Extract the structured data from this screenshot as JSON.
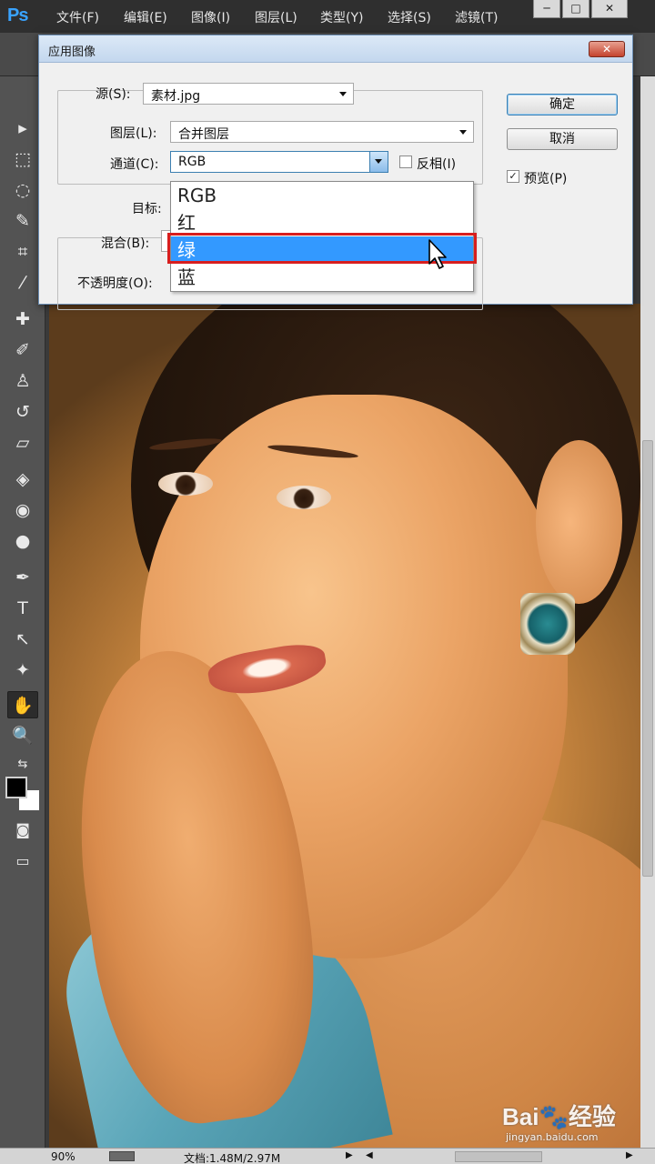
{
  "app": {
    "logo": "Ps",
    "menus": [
      "文件(F)",
      "编辑(E)",
      "图像(I)",
      "图层(L)",
      "类型(Y)",
      "选择(S)",
      "滤镜(T)"
    ],
    "window_controls": {
      "minimize": "─",
      "restore": "□",
      "close": "✕"
    }
  },
  "dialog": {
    "title": "应用图像",
    "close_glyph": "✕",
    "source_label": "源(S):",
    "source_value": "素材.jpg",
    "layer_label": "图层(L):",
    "layer_value": "合并图层",
    "channel_label": "通道(C):",
    "channel_value": "RGB",
    "invert_label": "反相(I)",
    "invert_checked": false,
    "target_label": "目标:",
    "blend_label": "混合(B):",
    "opacity_label": "不透明度(O):",
    "ok_label": "确定",
    "cancel_label": "取消",
    "preview_label": "预览(P)",
    "preview_checked": true,
    "preview_check_glyph": "✓"
  },
  "channel_dropdown": {
    "items": [
      "RGB",
      "红",
      "绿",
      "蓝"
    ],
    "selected_index": 2
  },
  "statusbar": {
    "zoom": "90%",
    "doc_info": "文档:1.48M/2.97M",
    "arrow": "▶",
    "scroll_left": "◀",
    "scroll_right": "▶"
  },
  "tools": [
    {
      "name": "move-tool-icon",
      "glyph": "▸"
    },
    {
      "name": "marquee-tool-icon",
      "glyph": "⬚"
    },
    {
      "name": "lasso-tool-icon",
      "glyph": "◌"
    },
    {
      "name": "quick-select-tool-icon",
      "glyph": "✎"
    },
    {
      "name": "crop-tool-icon",
      "glyph": "⌗"
    },
    {
      "name": "eyedropper-tool-icon",
      "glyph": "⁄"
    },
    {
      "name": "healing-brush-tool-icon",
      "glyph": "✚"
    },
    {
      "name": "brush-tool-icon",
      "glyph": "✐"
    },
    {
      "name": "clone-stamp-tool-icon",
      "glyph": "♙"
    },
    {
      "name": "history-brush-tool-icon",
      "glyph": "↺"
    },
    {
      "name": "eraser-tool-icon",
      "glyph": "▱"
    },
    {
      "name": "paint-bucket-tool-icon",
      "glyph": "◈"
    },
    {
      "name": "blur-tool-icon",
      "glyph": "◉"
    },
    {
      "name": "dodge-tool-icon",
      "glyph": "●"
    },
    {
      "name": "pen-tool-icon",
      "glyph": "✒"
    },
    {
      "name": "type-tool-icon",
      "glyph": "T"
    },
    {
      "name": "path-select-tool-icon",
      "glyph": "↖"
    },
    {
      "name": "shape-tool-icon",
      "glyph": "✦"
    },
    {
      "name": "hand-tool-icon",
      "glyph": "✋"
    },
    {
      "name": "zoom-tool-icon",
      "glyph": "🔍"
    }
  ],
  "toolbox_extra": {
    "swap_colors": "⇆",
    "quick_mask": "◙",
    "screen_mode": "▭",
    "collapse": "»"
  },
  "watermark": {
    "logo": "Bai🐾经验",
    "url": "jingyan.baidu.com"
  },
  "colors": {
    "selection": "#3399ff",
    "highlight_border": "#d81e1e",
    "ps_blue": "#39a3ff"
  }
}
